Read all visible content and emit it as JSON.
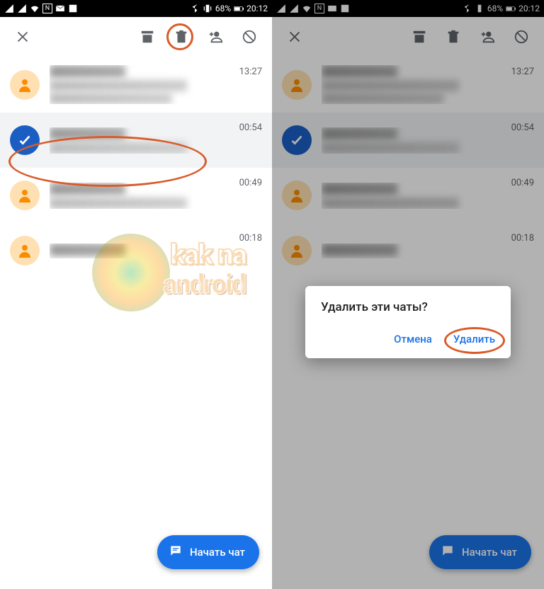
{
  "statusbar": {
    "battery_pct": "68%",
    "time": "20:12"
  },
  "fab": {
    "label": "Начать чат"
  },
  "conversations": [
    {
      "time": "13:27",
      "selected": false,
      "two_line_preview": true
    },
    {
      "time": "00:54",
      "selected": true,
      "two_line_preview": false
    },
    {
      "time": "00:49",
      "selected": false,
      "two_line_preview": false
    },
    {
      "time": "00:18",
      "selected": false,
      "two_line_preview": false
    }
  ],
  "dialog": {
    "title": "Удалить эти чаты?",
    "cancel": "Отмена",
    "confirm": "Удалить"
  },
  "watermark": {
    "line1": "kak na",
    "line2": "android"
  }
}
